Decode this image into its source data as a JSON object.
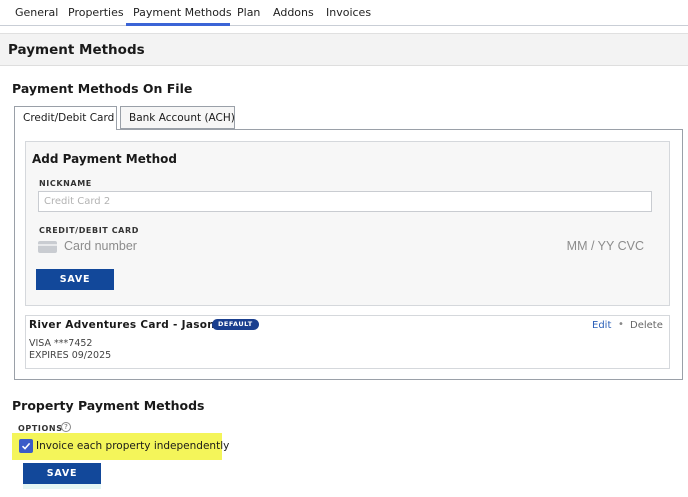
{
  "nav": {
    "tabs": [
      {
        "label": "General"
      },
      {
        "label": "Properties"
      },
      {
        "label": "Payment Methods",
        "active": true
      },
      {
        "label": "Plan"
      },
      {
        "label": "Addons"
      },
      {
        "label": "Invoices"
      }
    ]
  },
  "page": {
    "title": "Payment Methods"
  },
  "on_file": {
    "title": "Payment Methods On File",
    "tabs": {
      "card_label": "Credit/Debit Card",
      "bank_label": "Bank Account (ACH)"
    },
    "add": {
      "title": "Add Payment Method",
      "nickname_label": "NICKNAME",
      "nickname_placeholder": "Credit Card 2",
      "card_label": "CREDIT/DEBIT CARD",
      "card_number_placeholder": "Card number",
      "card_exp_placeholder": "MM / YY  CVC",
      "save_label": "SAVE"
    },
    "saved_card": {
      "name": "River Adventures Card - Jason",
      "badge": "DEFAULT",
      "number": "VISA ***7452",
      "expires": "EXPIRES 09/2025",
      "edit_label": "Edit",
      "separator": "•",
      "delete_label": "Delete"
    }
  },
  "property": {
    "title": "Property Payment Methods",
    "options_label": "OPTIONS",
    "help_glyph": "?",
    "checkbox_label": "Invoice each property independently",
    "checkbox_checked": true,
    "save_label": "SAVE"
  },
  "colors": {
    "accent": "#3b64d6",
    "button": "#12489a",
    "badge": "#1a3f8f",
    "highlight": "#f4f55a",
    "checkbox": "#3b5cc8"
  }
}
